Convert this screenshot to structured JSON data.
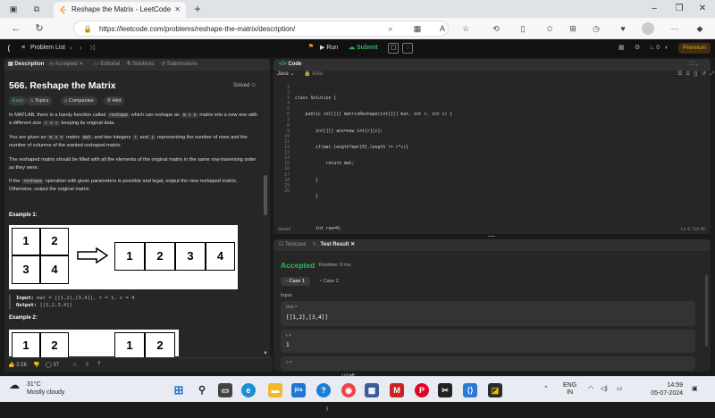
{
  "browser": {
    "tab_title": "Reshape the Matrix - LeetCode",
    "url": "https://leetcode.com/problems/reshape-the-matrix/description/"
  },
  "lc_topbar": {
    "problem_list": "Problem List",
    "run": "Run",
    "submit": "Submit",
    "coins": "0",
    "premium": "Premium"
  },
  "desc_panel": {
    "tabs": [
      "Description",
      "Accepted",
      "Editorial",
      "Solutions",
      "Submissions"
    ],
    "title": "566. Reshape the Matrix",
    "solved": "Solved",
    "chips": [
      "Easy",
      "Topics",
      "Companies",
      "Hint"
    ],
    "p1a": "In MATLAB, there is a handy function called",
    "p1_code": "reshape",
    "p1b": "which can reshape an",
    "p1_code2": "m x n",
    "p1c": "matrix into a new one",
    "p1d": "with a different size",
    "p1_code3": "r x c",
    "p1e": "keeping its original data.",
    "p2a": "You are given an",
    "p2_code": "m x n",
    "p2b": "matrix",
    "p2_code2": "mat",
    "p2c": "and two integers",
    "p2_code3": "r",
    "p2d": "and",
    "p2_code4": "c",
    "p2e": "representing the number of rows and the",
    "p2f": "number of columns of the wanted reshaped matrix.",
    "p3": "The reshaped matrix should be filled with all the elements of the original matrix in the same row-traversing order as they were.",
    "p4a": "If the",
    "p4_code": "reshape",
    "p4b": "operation with given parameters is possible and legal, output the new reshaped matrix; Otherwise, output the original matrix.",
    "example1": "Example 1:",
    "example2": "Example 2:",
    "ex1_matrix": [
      "1",
      "2",
      "3",
      "4"
    ],
    "ex1_result": [
      "1",
      "2",
      "3",
      "4"
    ],
    "ex1_input_label": "Input:",
    "ex1_input": "mat = [[1,2],[3,4]], r = 1, c = 4",
    "ex1_output_label": "Output:",
    "ex1_output": "[[1,2,3,4]]",
    "ex2_matrix": [
      "1",
      "2"
    ],
    "ex2_result": [
      "1",
      "2"
    ],
    "likes": "3.5K",
    "comments": "37"
  },
  "code_panel": {
    "title": "Code",
    "language": "Java",
    "auto": "Auto",
    "line_numbers": [
      "1",
      "2",
      "3",
      "4",
      "5",
      "6",
      "7",
      "8",
      "9",
      "10",
      "11",
      "12",
      "13",
      "14",
      "15",
      "16",
      "17",
      "18",
      "19",
      "20"
    ],
    "lines": [
      "class Solution {",
      "    public int[][] matrixReshape(int[][] mat, int r, int c) {",
      "        int[][] ans=new int[r][c];",
      "        if(mat.length*mat[0].length != r*c){",
      "            return mat;",
      "        }",
      "        }",
      "",
      "        int row=0;",
      "        int col=0;",
      "        for(int i=0;i<mat.length;i++){",
      "            for(int j=0;j<mat[0].length;j++){",
      "              ans[row][col]=mat[i][j];",
      "              col++;",
      "",
      "              if(col==c){",
      "                  row++;",
      "                  col=0;",
      "              }",
      "            }"
    ],
    "saved": "Saved",
    "position": "Ln 4, Col 45"
  },
  "result_panel": {
    "tabs": [
      "Testcase",
      "Test Result"
    ],
    "status": "Accepted",
    "runtime": "Runtime: 0 ms",
    "case1": "Case 1",
    "case2": "Case 2",
    "input": "Input",
    "mat_label": "mat =",
    "mat_val": "[[1,2],[3,4]]",
    "r_label": "r =",
    "r_val": "1",
    "c_label": "c ="
  },
  "taskbar": {
    "temperature": "31°C",
    "weather": "Mostly cloudy",
    "lang1": "ENG",
    "lang2": "IN",
    "time": "14:59",
    "date": "05-07-2024"
  },
  "colors": {
    "accent_green": "#2cbb5d",
    "premium_orange": "#ffa116",
    "panel_bg": "#262626"
  }
}
